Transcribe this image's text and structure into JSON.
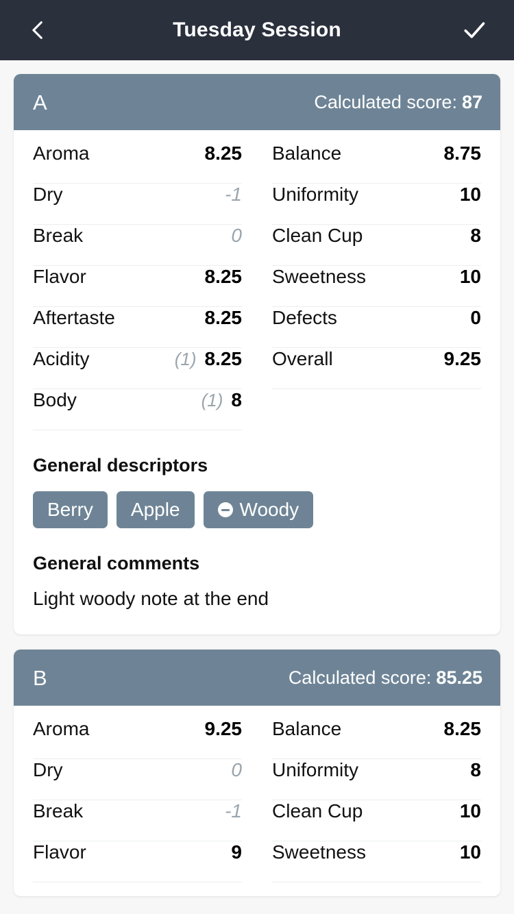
{
  "appbar": {
    "title": "Tuesday Session",
    "back_icon": "chevron-left-icon",
    "confirm_icon": "check-icon"
  },
  "labels": {
    "score_prefix": "Calculated score:",
    "descriptors_title": "General descriptors",
    "comments_title": "General comments"
  },
  "colors": {
    "appbar_bg": "#2b303d",
    "card_header_bg": "#6e8496",
    "page_bg": "#f7f7f7",
    "card_bg": "#ffffff",
    "muted_text": "#9aa5ad",
    "divider": "#eceded"
  },
  "cards": [
    {
      "letter": "A",
      "score": "87",
      "left_rows": [
        {
          "label": "Aroma",
          "note": "",
          "value": "8.25",
          "muted": false
        },
        {
          "label": "Dry",
          "note": "",
          "value": "-1",
          "muted": true
        },
        {
          "label": "Break",
          "note": "",
          "value": "0",
          "muted": true
        },
        {
          "label": "Flavor",
          "note": "",
          "value": "8.25",
          "muted": false
        },
        {
          "label": "Aftertaste",
          "note": "",
          "value": "8.25",
          "muted": false
        },
        {
          "label": "Acidity",
          "note": "(1)",
          "value": "8.25",
          "muted": false
        },
        {
          "label": "Body",
          "note": "(1)",
          "value": "8",
          "muted": false
        }
      ],
      "right_rows": [
        {
          "label": "Balance",
          "note": "",
          "value": "8.75",
          "muted": false
        },
        {
          "label": "Uniformity",
          "note": "",
          "value": "10",
          "muted": false
        },
        {
          "label": "Clean Cup",
          "note": "",
          "value": "8",
          "muted": false
        },
        {
          "label": "Sweetness",
          "note": "",
          "value": "10",
          "muted": false
        },
        {
          "label": "Defects",
          "note": "",
          "value": "0",
          "muted": false
        },
        {
          "label": "Overall",
          "note": "",
          "value": "9.25",
          "muted": false
        }
      ],
      "descriptors": [
        {
          "label": "Berry",
          "icon": ""
        },
        {
          "label": "Apple",
          "icon": ""
        },
        {
          "label": "Woody",
          "icon": "minus-circle-icon"
        }
      ],
      "comment": "Light woody note at the end"
    },
    {
      "letter": "B",
      "score": "85.25",
      "left_rows": [
        {
          "label": "Aroma",
          "note": "",
          "value": "9.25",
          "muted": false
        },
        {
          "label": "Dry",
          "note": "",
          "value": "0",
          "muted": true
        },
        {
          "label": "Break",
          "note": "",
          "value": "-1",
          "muted": true
        },
        {
          "label": "Flavor",
          "note": "",
          "value": "9",
          "muted": false
        }
      ],
      "right_rows": [
        {
          "label": "Balance",
          "note": "",
          "value": "8.25",
          "muted": false
        },
        {
          "label": "Uniformity",
          "note": "",
          "value": "8",
          "muted": false
        },
        {
          "label": "Clean Cup",
          "note": "",
          "value": "10",
          "muted": false
        },
        {
          "label": "Sweetness",
          "note": "",
          "value": "10",
          "muted": false
        }
      ],
      "descriptors": [],
      "comment": ""
    }
  ]
}
